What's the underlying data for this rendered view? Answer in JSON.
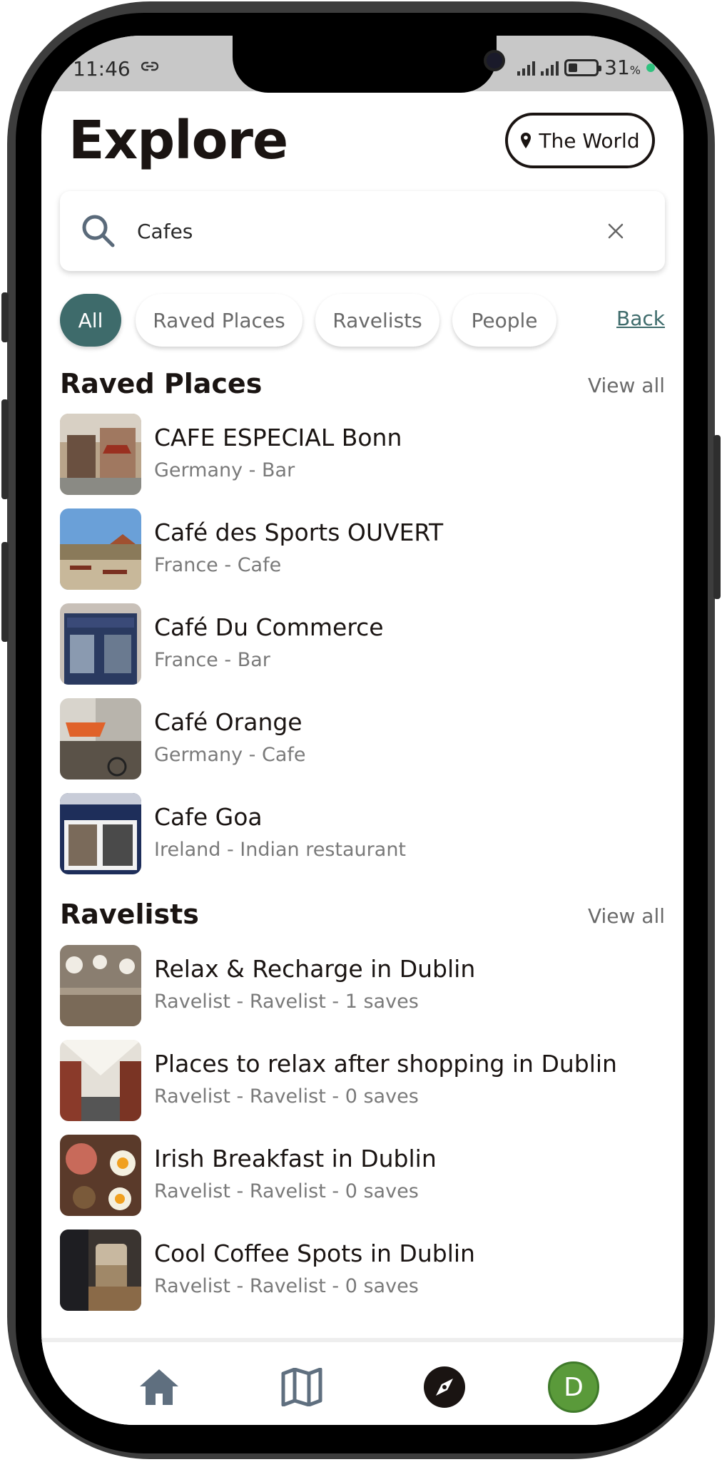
{
  "status_bar": {
    "time": "11:46",
    "battery": "31",
    "battery_unit": "%"
  },
  "header": {
    "title": "Explore",
    "location_label": "The World"
  },
  "search": {
    "value": "Cafes"
  },
  "filters": {
    "chips": [
      "All",
      "Raved Places",
      "Ravelists",
      "People"
    ],
    "active": "All",
    "back_label": "Back"
  },
  "raved_places": {
    "title": "Raved Places",
    "view_all": "View all",
    "items": [
      {
        "name": "CAFE ESPECIAL Bonn",
        "subtitle": "Germany - Bar"
      },
      {
        "name": "Café des Sports OUVERT",
        "subtitle": "France - Cafe"
      },
      {
        "name": "Café Du Commerce",
        "subtitle": "France - Bar"
      },
      {
        "name": "Café Orange",
        "subtitle": "Germany - Cafe"
      },
      {
        "name": "Cafe Goa",
        "subtitle": "Ireland - Indian restaurant"
      }
    ]
  },
  "ravelists": {
    "title": "Ravelists",
    "view_all": "View all",
    "items": [
      {
        "name": "Relax & Recharge in Dublin",
        "subtitle": "Ravelist - Ravelist - 1 saves"
      },
      {
        "name": "Places to relax after shopping in Dublin",
        "subtitle": "Ravelist - Ravelist - 0 saves"
      },
      {
        "name": "Irish Breakfast in Dublin",
        "subtitle": "Ravelist - Ravelist - 0 saves"
      },
      {
        "name": "Cool Coffee Spots in Dublin",
        "subtitle": "Ravelist - Ravelist - 0 saves"
      }
    ]
  },
  "bottom_nav": {
    "items": [
      "home-icon",
      "map-icon",
      "explore-compass-icon",
      "profile-avatar"
    ],
    "avatar_initial": "D"
  },
  "colors": {
    "accent": "#3e6b6b",
    "avatar": "#5a9a3a",
    "text": "#1a1412",
    "muted": "#7a7a7a"
  }
}
